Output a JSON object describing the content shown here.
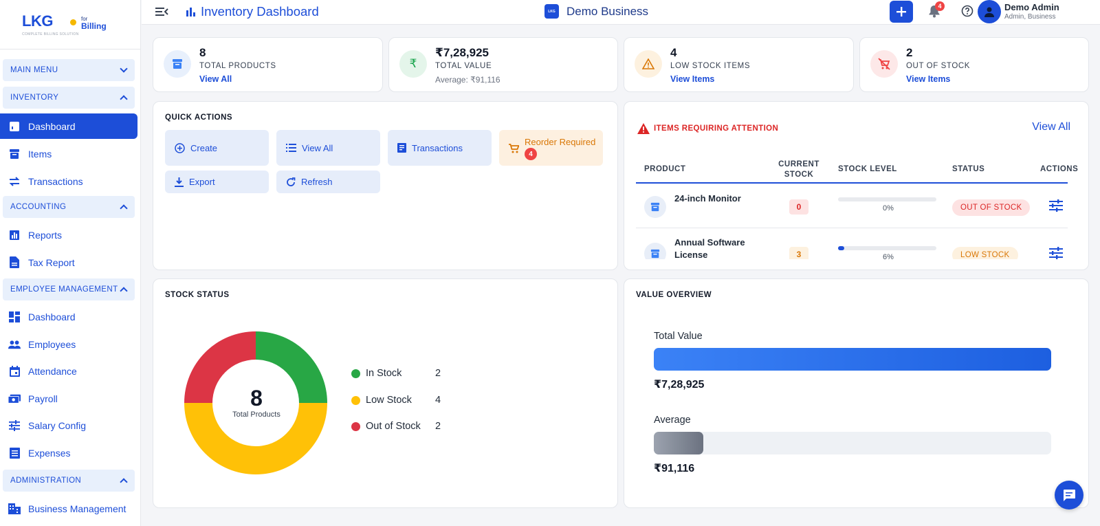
{
  "brand": {
    "logo": "LKG",
    "for": "for",
    "billing": "Billing",
    "tagline": "COMPLETE BILLING SOLUTION"
  },
  "sidebar": {
    "sections": [
      {
        "label": "MAIN MENU",
        "expanded": false
      },
      {
        "label": "INVENTORY",
        "expanded": true
      },
      {
        "label": "ACCOUNTING",
        "expanded": true
      },
      {
        "label": "EMPLOYEE MANAGEMENT",
        "expanded": true
      },
      {
        "label": "ADMINISTRATION",
        "expanded": true
      }
    ],
    "items": [
      {
        "label": "Dashboard",
        "icon": "dashboard-chart-icon",
        "active": true
      },
      {
        "label": "Items",
        "icon": "archive-icon"
      },
      {
        "label": "Transactions",
        "icon": "swap-arrows-icon"
      },
      {
        "label": "Reports",
        "icon": "bar-chart-icon"
      },
      {
        "label": "Tax Report",
        "icon": "document-icon"
      },
      {
        "label": "Dashboard",
        "icon": "grid-dashboard-icon"
      },
      {
        "label": "Employees",
        "icon": "people-icon"
      },
      {
        "label": "Attendance",
        "icon": "calendar-icon"
      },
      {
        "label": "Payroll",
        "icon": "money-icon"
      },
      {
        "label": "Salary Config",
        "icon": "sliders-icon"
      },
      {
        "label": "Expenses",
        "icon": "list-icon"
      },
      {
        "label": "Business Management",
        "icon": "building-icon"
      }
    ]
  },
  "header": {
    "title": "Inventory Dashboard",
    "business": "Demo Business",
    "business_logo": "LKG",
    "notification_count": "4",
    "user_name": "Demo Admin",
    "user_role": "Admin, Business"
  },
  "stats": [
    {
      "value": "8",
      "label": "TOTAL PRODUCTS",
      "link": "View All",
      "icon": "archive-icon",
      "color": "#3b82f6"
    },
    {
      "value": "₹7,28,925",
      "label": "TOTAL VALUE",
      "sub": "Average: ₹91,116",
      "icon": "rupee-icon",
      "color": "#16a34a"
    },
    {
      "value": "4",
      "label": "LOW STOCK ITEMS",
      "link": "View Items",
      "icon": "warning-icon",
      "color": "#d97706"
    },
    {
      "value": "2",
      "label": "OUT OF STOCK",
      "link": "View Items",
      "icon": "cart-off-icon",
      "color": "#ef4444"
    }
  ],
  "quick_actions": {
    "title": "QUICK ACTIONS",
    "buttons": [
      {
        "label": "Create",
        "icon": "plus-circle-icon"
      },
      {
        "label": "View All",
        "icon": "list-icon"
      },
      {
        "label": "Transactions",
        "icon": "receipt-icon"
      },
      {
        "label": "Reorder Required",
        "icon": "cart-icon",
        "badge": "4"
      },
      {
        "label": "Export",
        "icon": "download-icon"
      },
      {
        "label": "Refresh",
        "icon": "refresh-icon"
      }
    ]
  },
  "attention": {
    "title": "ITEMS REQUIRING ATTENTION",
    "view_all": "View All",
    "columns": [
      "PRODUCT",
      "CURRENT STOCK",
      "STOCK LEVEL",
      "STATUS",
      "ACTIONS"
    ],
    "rows": [
      {
        "product": "24-inch Monitor",
        "stock": "0",
        "level_pct": 0,
        "level_label": "0%",
        "status": "OUT OF STOCK"
      },
      {
        "product": "Annual Software License",
        "stock": "3",
        "level_pct": 6,
        "level_label": "6%",
        "status": "LOW STOCK"
      }
    ]
  },
  "stock_status": {
    "title": "STOCK STATUS",
    "center_value": "8",
    "center_label": "Total Products",
    "legend": [
      {
        "label": "In Stock",
        "value": "2",
        "color": "#28a745"
      },
      {
        "label": "Low Stock",
        "value": "4",
        "color": "#ffc107"
      },
      {
        "label": "Out of Stock",
        "value": "2",
        "color": "#dc3545"
      }
    ]
  },
  "chart_data": {
    "type": "pie",
    "categories": [
      "In Stock",
      "Low Stock",
      "Out of Stock"
    ],
    "values": [
      2,
      4,
      2
    ],
    "title": "STOCK STATUS"
  },
  "value_overview": {
    "title": "VALUE OVERVIEW",
    "total_label": "Total Value",
    "total_value": "₹7,28,925",
    "total_fill": 1.0,
    "avg_label": "Average",
    "avg_value": "₹91,116",
    "avg_fill": 0.125
  }
}
